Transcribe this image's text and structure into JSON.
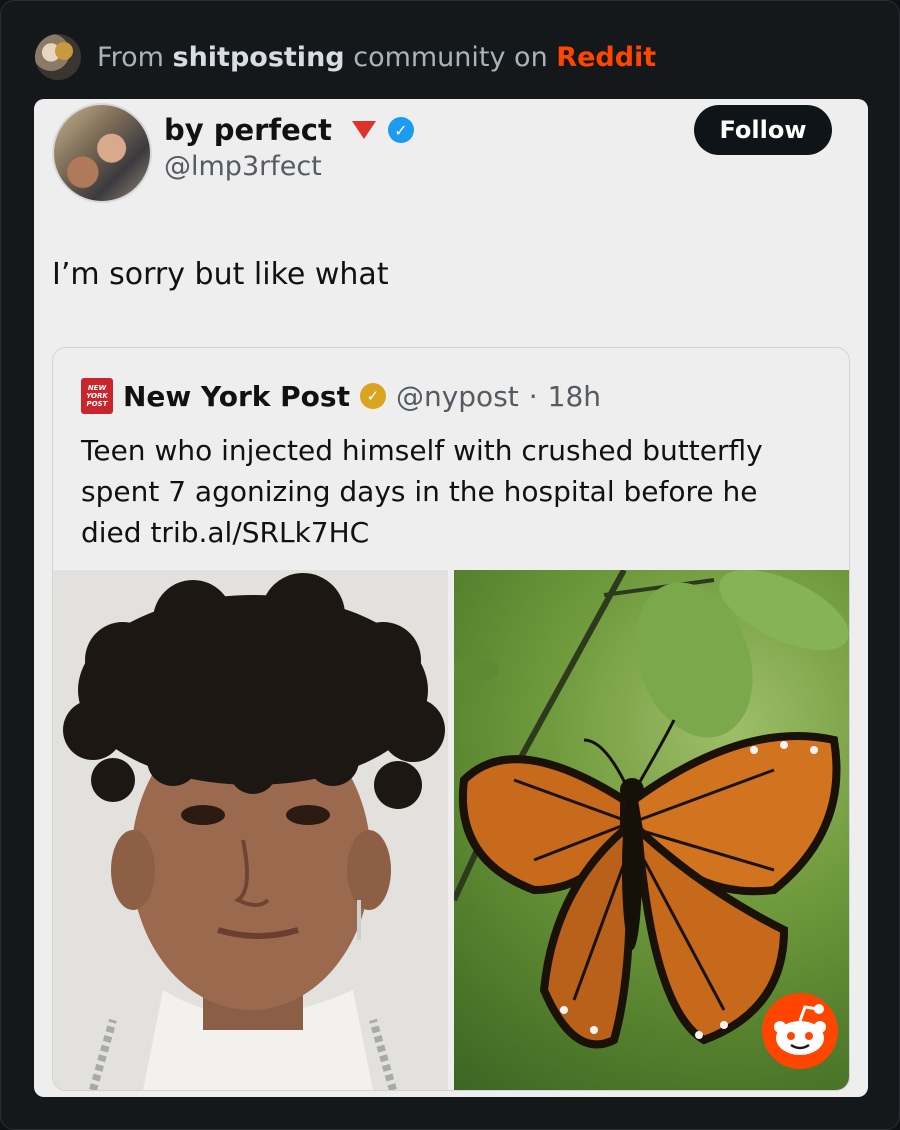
{
  "source": {
    "prefix": "From",
    "community": "shitposting",
    "middle": "community on",
    "platform": "Reddit",
    "platform_color": "#ff4500"
  },
  "tweet": {
    "display_name": "by perfect",
    "handle": "@lmp3rfect",
    "follow_label": "Follow",
    "text": "I’m sorry but like what",
    "icons": [
      "red-triangle-icon",
      "verified-check-icon"
    ]
  },
  "quote": {
    "logo_text": "NEW YORK POST",
    "name": "New York Post",
    "handle": "@nypost",
    "separator": "·",
    "time": "18h",
    "text": "Teen who injected himself with crushed butterfly spent 7 agonizing days in the hospital before he died trib.al/SRLk7HC",
    "media": [
      {
        "name": "teen-photo"
      },
      {
        "name": "monarch-butterfly-photo"
      }
    ]
  },
  "colors": {
    "background": "#15181b",
    "card": "#eeeeef",
    "verified_blue": "#1d9bf0",
    "gold_badge": "#d9a520",
    "follow_button": "#0f1419"
  }
}
